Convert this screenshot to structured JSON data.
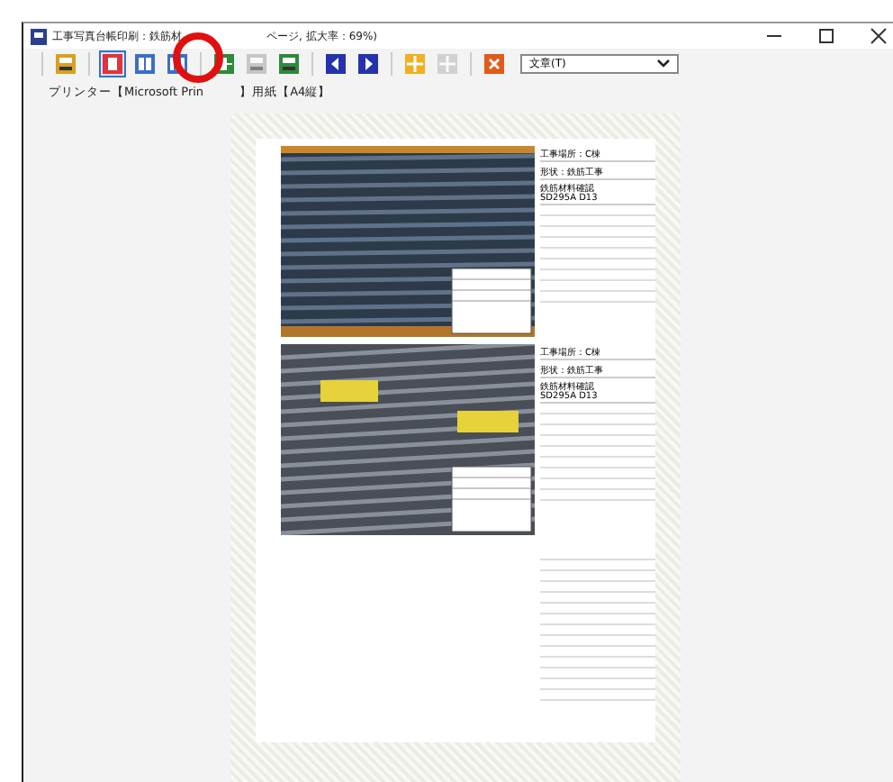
{
  "window": {
    "title_start": "工事写真台帳印刷：鉄筋材",
    "title_end": "ページ, 拡大率：69%)"
  },
  "toolbar": {
    "buttons": [
      {
        "kind": "print",
        "disabled": false
      },
      {
        "kind": "single",
        "disabled": false,
        "selected": true
      },
      {
        "kind": "double",
        "disabled": false,
        "selected": false
      },
      {
        "kind": "triple",
        "disabled": false,
        "selected": false
      },
      {
        "kind": "export",
        "disabled": false
      },
      {
        "kind": "print",
        "disabled": true
      },
      {
        "kind": "print-green",
        "disabled": false
      },
      {
        "kind": "prev",
        "disabled": false
      },
      {
        "kind": "next",
        "disabled": false
      },
      {
        "kind": "zoom-in",
        "disabled": false
      },
      {
        "kind": "zoom-out",
        "disabled": true
      },
      {
        "kind": "close",
        "disabled": false
      }
    ],
    "font_select": {
      "value": "文章(T)"
    }
  },
  "printer_info": {
    "start": "プリンター【Microsoft Prin",
    "end": "】用紙【A4縦】"
  },
  "entries": [
    {
      "kind": "flat",
      "lines": [
        "工事場所：C棟",
        "形状：鉄筋工事"
      ],
      "note": [
        "鉄筋材料確認",
        "SD295A D13"
      ]
    },
    {
      "kind": "ribbed",
      "lines": [
        "工事場所：C棟",
        "形状：鉄筋工事"
      ],
      "note": [
        "鉄筋材料確認",
        "SD295A D13"
      ]
    }
  ]
}
